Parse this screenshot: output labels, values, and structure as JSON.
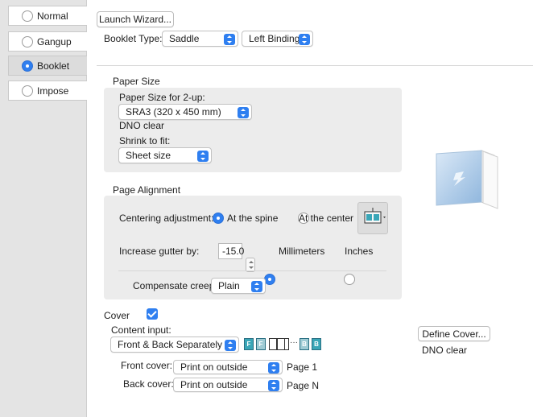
{
  "sidebar": {
    "items": [
      {
        "label": "Normal",
        "selected": false
      },
      {
        "label": "Gangup",
        "selected": false
      },
      {
        "label": "Booklet",
        "selected": true
      },
      {
        "label": "Impose",
        "selected": false
      }
    ]
  },
  "toolbar": {
    "launch_wizard_label": "Launch Wizard...",
    "booklet_type_label": "Booklet Type:",
    "booklet_type_value": "Saddle",
    "binding_value": "Left Binding"
  },
  "paper_size": {
    "title": "Paper Size",
    "size_label": "Paper Size for 2-up:",
    "size_value": "SRA3 (320 x 450 mm)",
    "status": "DNO clear",
    "shrink_label": "Shrink to fit:",
    "shrink_value": "Sheet size"
  },
  "page_alignment": {
    "title": "Page Alignment",
    "centering_label": "Centering adjustment:",
    "centering_options": [
      {
        "label": "At the spine",
        "selected": true
      },
      {
        "label": "At the center",
        "selected": false
      }
    ],
    "gutter_label": "Increase gutter by:",
    "gutter_value": "-15.0",
    "unit_options": [
      {
        "label": "Millimeters",
        "selected": true
      },
      {
        "label": "Inches",
        "selected": false
      }
    ],
    "creep_label": "Compensate creep",
    "creep_checked": true,
    "creep_value": "Plain"
  },
  "cover": {
    "title": "Cover",
    "content_input_label": "Content input:",
    "content_input_value": "Front & Back Separately",
    "define_cover_label": "Define Cover...",
    "status": "DNO clear",
    "front_label": "Front cover:",
    "front_value": "Print on outside",
    "front_page": "Page 1",
    "back_label": "Back cover:",
    "back_value": "Print on outside",
    "back_page": "Page N",
    "diagram_letters": [
      "F",
      "F",
      "B",
      "B"
    ],
    "diagram_ellipsis": "···"
  },
  "colors": {
    "accent": "#2f7ff0",
    "group_bg": "#ececec",
    "sidebar_bg": "#e4e4e4",
    "cover_tile": "#3aa6b7"
  }
}
